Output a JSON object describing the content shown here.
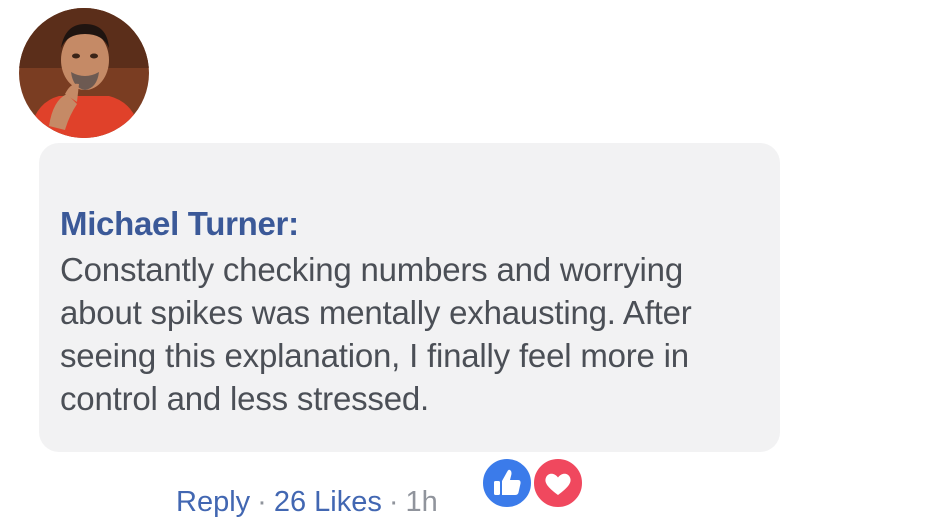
{
  "comment": {
    "author": "Michael Turner:",
    "text": "Constantly checking numbers and worrying about spikes was mentally exhausting. After seeing this explanation, I finally feel more in control and less stressed."
  },
  "actions": {
    "reply_label": "Reply",
    "separator": "·",
    "likes_label": "26 Likes",
    "time": "1h"
  },
  "reactions": [
    {
      "type": "like",
      "icon": "thumbs-up-icon",
      "color": "#3b7bea"
    },
    {
      "type": "love",
      "icon": "heart-icon",
      "color": "#f0485e"
    }
  ],
  "colors": {
    "author": "#3b5998",
    "link": "#4267b2",
    "bubble": "#f2f2f3",
    "text": "#4b4f56",
    "muted": "#90949c"
  }
}
